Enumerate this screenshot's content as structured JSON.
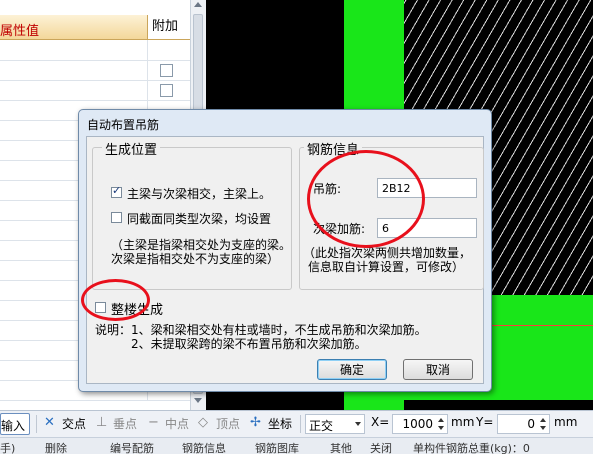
{
  "property_panel": {
    "col_value": "属性值",
    "col_extra": "附加"
  },
  "dialog": {
    "title": "自动布置吊筋",
    "position_group": {
      "title": "生成位置",
      "option_main_secondary": "主梁与次梁相交，主梁上。",
      "option_main_secondary_checked": true,
      "option_same_type": "同截面同类型次梁，均设置",
      "option_same_type_checked": false,
      "note_line1": "（主梁是指梁相交处为支座的梁。",
      "note_line2": "次梁是指相交处不为支座的梁）"
    },
    "rebar_group": {
      "title": "钢筋信息",
      "hanger_label": "吊筋:",
      "hanger_value": "2B12",
      "stirrup_label": "次梁加筋:",
      "stirrup_value": "6",
      "note_line1": "（此处指次梁两侧共增加数量，",
      "note_line2": "信息取自计算设置，可修改）"
    },
    "whole_floor_label": "整楼生成",
    "whole_floor_checked": false,
    "explain_line1": "说明：1、梁和梁相交处有柱或墙时，不生成吊筋和次梁加筋。",
    "explain_line2": "2、未提取梁跨的梁不布置吊筋和次梁加筋。",
    "ok_label": "确定",
    "cancel_label": "取消"
  },
  "toolbar": {
    "input_label": "输入",
    "intersection": "交点",
    "perpendicular": "垂点",
    "midpoint": "中点",
    "vertex": "顶点",
    "coordinate": "坐标",
    "ortho_mode": "正交",
    "x_label": "X=",
    "x_value": "1000",
    "x_unit": "mm",
    "y_label": "Y=",
    "y_value": "0",
    "y_unit": "mm"
  },
  "toolbar2": {
    "items": [
      "手)",
      "删除",
      "编号配筋",
      "钢筋信息",
      "钢筋图库",
      "其他",
      "关闭",
      "单构件钢筋总重(kg)：0"
    ]
  },
  "colors": {
    "green": "#19e619",
    "annotation_red": "#e8101c",
    "header_red_text": "#c00000"
  }
}
